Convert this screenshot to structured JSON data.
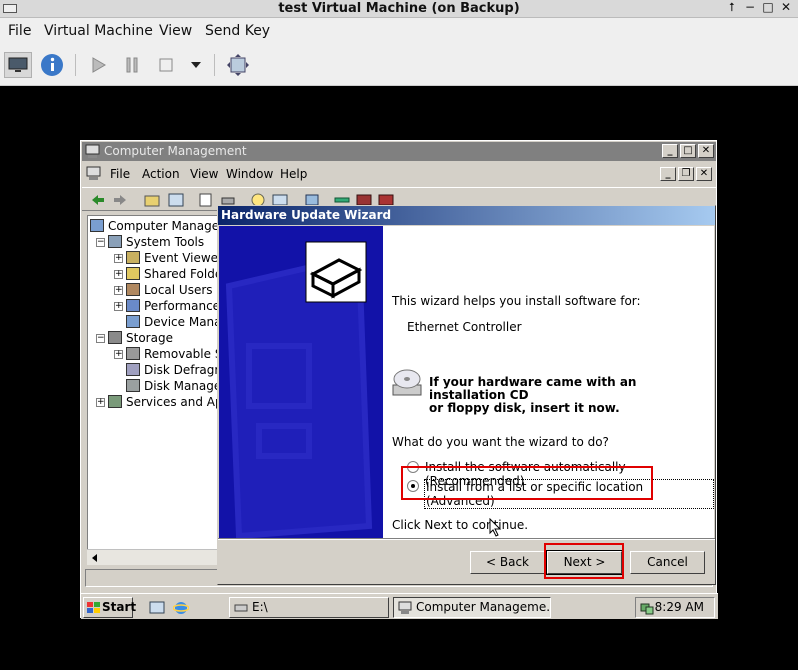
{
  "host": {
    "title": "test Virtual Machine (on Backup)",
    "menu": [
      "File",
      "Virtual Machine",
      "View",
      "Send Key"
    ],
    "toolbar_icons": [
      "monitor-icon",
      "info-icon",
      "play-icon",
      "pause-icon",
      "stop-icon",
      "dropdown-icon",
      "fit-window-icon"
    ]
  },
  "computer_management": {
    "title": "Computer Management",
    "menu": [
      "File",
      "Action",
      "View",
      "Window",
      "Help"
    ],
    "tree": [
      {
        "label": "Computer Managemer",
        "level": 0,
        "expander": ""
      },
      {
        "label": "System Tools",
        "level": 1,
        "expander": "−"
      },
      {
        "label": "Event Viewer",
        "level": 2,
        "expander": "+"
      },
      {
        "label": "Shared Folder",
        "level": 2,
        "expander": "+"
      },
      {
        "label": "Local Users ar",
        "level": 2,
        "expander": "+"
      },
      {
        "label": "Performance L",
        "level": 2,
        "expander": "+"
      },
      {
        "label": "Device Manag",
        "level": 2,
        "expander": ""
      },
      {
        "label": "Storage",
        "level": 1,
        "expander": "−"
      },
      {
        "label": "Removable St",
        "level": 2,
        "expander": "+"
      },
      {
        "label": "Disk Defragme",
        "level": 2,
        "expander": ""
      },
      {
        "label": "Disk Managem",
        "level": 2,
        "expander": ""
      },
      {
        "label": "Services and Appli",
        "level": 1,
        "expander": "+"
      }
    ]
  },
  "wizard": {
    "title": "Hardware Update Wizard",
    "intro": "This wizard helps you install software for:",
    "device": "Ethernet Controller",
    "cd_prompt_line1": "If your hardware came with an installation CD",
    "cd_prompt_line2": "or floppy disk, insert it now.",
    "question": "What do you want the wizard to do?",
    "options": [
      {
        "label": "Install the software automatically (Recommended)",
        "selected": false
      },
      {
        "label": "Install from a list or specific location (Advanced)",
        "selected": true
      }
    ],
    "footer": "Click Next to continue.",
    "buttons": {
      "back": "< Back",
      "next": "Next >",
      "cancel": "Cancel"
    }
  },
  "taskbar": {
    "start": "Start",
    "tasks": [
      "E:\\",
      "Computer Manageme..."
    ],
    "clock": "8:29 AM"
  },
  "colors": {
    "highlight": "#e00000",
    "wizard_panel": "#1212a8",
    "title_active": "#0a246a"
  }
}
